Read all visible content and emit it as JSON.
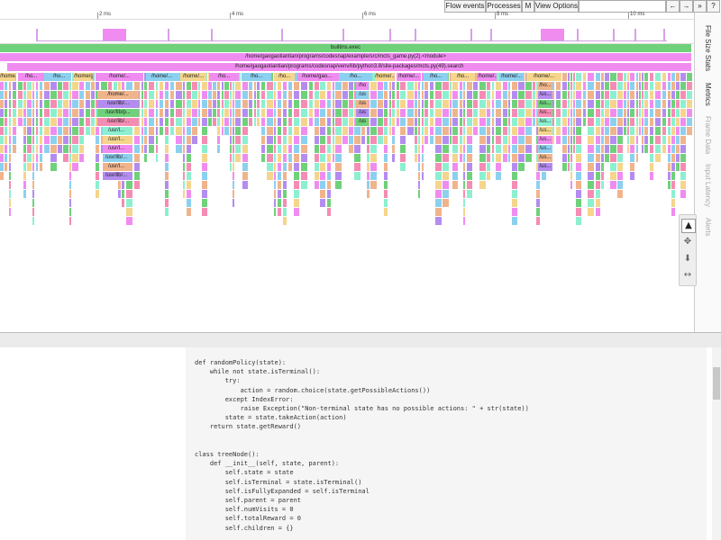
{
  "toolbar": {
    "flow_events": "Flow events",
    "processes": "Processes",
    "m": "M",
    "view_options": "View Options",
    "nav_left": "←",
    "nav_right": "→",
    "expand": "»",
    "help": "?"
  },
  "ruler": {
    "ticks": [
      "2 ms",
      "4 ms",
      "6 ms",
      "8 ms",
      "10 ms"
    ]
  },
  "flame": {
    "row0": "builtins.exec",
    "row1": "/home/gaogaotiantian/programs/codesnap/example/src/mcts_game.py(2).<module>",
    "row2": "/home/gaogaotiantian/programs/codesnap/venv/lib/python3.8/site-packages/mcts.py(49).search",
    "row3": [
      "/home/gao...",
      "/ho...",
      "/ho...",
      "/home/gaogaot...",
      "/home/...",
      "/home/...",
      "/home/...",
      "/ho...",
      "/ho...",
      "/ho...",
      "/home/gao...",
      "/ho...",
      "/home/...",
      "/home/...",
      "/ho...",
      "/ho...",
      "/home/...",
      "/home/...",
      "/home/..."
    ],
    "row4": [
      "/home/...",
      "/ho...",
      "/home/gaoga...",
      "/home/...",
      "/home/...",
      "/home/...",
      "/home/...",
      "/ho...",
      "/ho...",
      "/home/..."
    ],
    "row5": "/home/...",
    "row6": "/usr/lib/...",
    "row7": "/usr/lib/p...",
    "row8": "/usr/lib/...",
    "row9": "/usr/l...",
    "row10": "/usr/l...",
    "row11": "/usr/l...",
    "row12": "/usr/lib/...",
    "row13": "/usr/l...",
    "row14": "/usr/lib/...",
    "col2_labels": [
      "/ho",
      "/us",
      "/us",
      "/us",
      "/us"
    ],
    "col3_labels": [
      "/ho...",
      "/us...",
      "/us...",
      "/us...",
      "/us...",
      "/us...",
      "/us...",
      "/us...",
      "/us...",
      "/us..."
    ]
  },
  "right_tabs": [
    "File Size Stats",
    "Metrics",
    "Frame Data",
    "Input Latency",
    "Alerts"
  ],
  "tools": [
    "select-tool",
    "pan-tool",
    "zoom-tool",
    "timing-tool"
  ],
  "code_lines": [
    "def randomPolicy(state):",
    "    while not state.isTerminal():",
    "        try:",
    "            action = random.choice(state.getPossibleActions())",
    "        except IndexError:",
    "            raise Exception(\"Non-terminal state has no possible actions: \" + str(state))",
    "        state = state.takeAction(action)",
    "    return state.getReward()",
    "",
    "",
    "class treeNode():",
    "    def __init__(self, state, parent):",
    "        self.state = state",
    "        self.isTerminal = state.isTerminal()",
    "        self.isFullyExpanded = self.isTerminal",
    "        self.parent = parent",
    "        self.numVisits = 0",
    "        self.totalReward = 0",
    "        self.children = {}"
  ]
}
